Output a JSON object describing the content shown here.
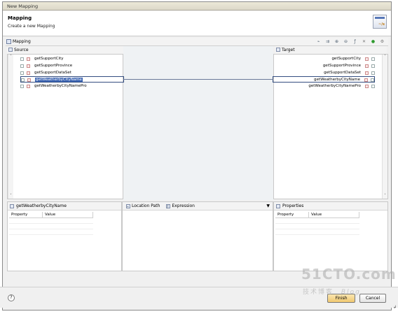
{
  "window": {
    "title": "New Mapping"
  },
  "header": {
    "title": "Mapping",
    "subtitle": "Create a new Mapping",
    "icon": "wizard-banner-icon"
  },
  "mapping_bar": {
    "label": "Mapping",
    "toolbar_icons": [
      "link-icon",
      "auto-map-icon",
      "map-icon",
      "unmap-icon",
      "function-icon",
      "remove-icon",
      "add-icon",
      "settings-icon"
    ]
  },
  "source": {
    "label": "Source",
    "items": [
      "getSupportCity",
      "getSupportProvince",
      "getSupportDataSet",
      "getWeatherbyCityName",
      "getWeatherbyCityNamePro"
    ],
    "selected_index": 3
  },
  "target": {
    "label": "Target",
    "items": [
      "getSupportCity",
      "getSupportProvince",
      "getSupportDataSet",
      "getWeatherbyCityName",
      "getWeatherbyCityNamePro"
    ],
    "selected_index": 3
  },
  "bottom": {
    "left_panel": {
      "title": "getWeatherbyCityName",
      "columns": [
        "Property",
        "Value"
      ]
    },
    "middle_panel": {
      "tabs": [
        "Location Path",
        "Expression"
      ]
    },
    "right_panel": {
      "title": "Properties",
      "columns": [
        "Property",
        "Value"
      ]
    }
  },
  "footer": {
    "help": "?",
    "finish_label": "Finish",
    "cancel_label": "Cancel"
  },
  "watermark": {
    "main": "51CTO.com",
    "sub": "技术博客",
    "blog": "Blog"
  },
  "return_mark": "↲"
}
